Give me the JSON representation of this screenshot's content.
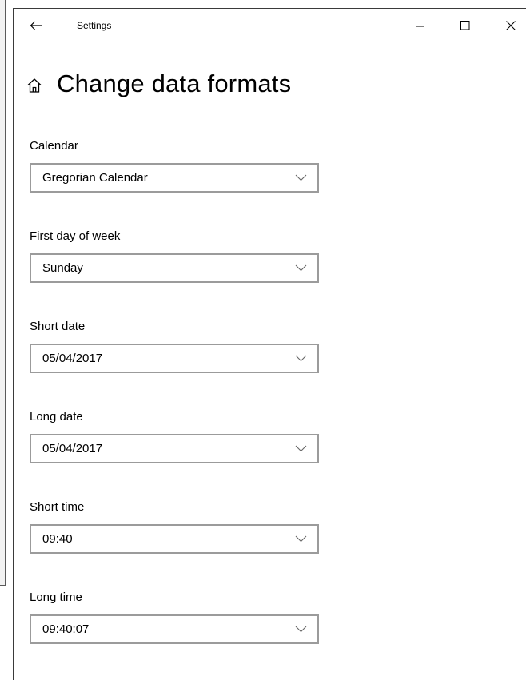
{
  "window": {
    "app_title": "Settings",
    "page_title": "Change data formats"
  },
  "icons": {
    "back": "back-arrow-icon",
    "home": "home-icon",
    "minimize": "minimize-icon",
    "maximize": "maximize-icon",
    "close": "close-icon",
    "dropdown": "chevron-down-icon"
  },
  "fields": [
    {
      "label": "Calendar",
      "value": "Gregorian Calendar"
    },
    {
      "label": "First day of week",
      "value": "Sunday"
    },
    {
      "label": "Short date",
      "value": "05/04/2017"
    },
    {
      "label": "Long date",
      "value": "05/04/2017"
    },
    {
      "label": "Short time",
      "value": "09:40"
    },
    {
      "label": "Long time",
      "value": "09:40:07"
    }
  ],
  "colors": {
    "combo_border": "#9b9b9b",
    "text": "#000000",
    "background": "#ffffff"
  }
}
